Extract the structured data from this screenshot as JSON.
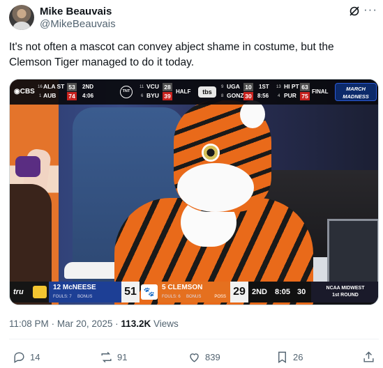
{
  "author": {
    "name": "Mike Beauvais",
    "handle": "@MikeBeauvais"
  },
  "tweet": {
    "text": "It's not often a mascot can convey abject shame in costume, but the Clemson Tiger managed to do it today."
  },
  "media": {
    "top_scoreboard": {
      "games": [
        {
          "network": "CBS",
          "teams": [
            {
              "seed": "16",
              "name": "ALA ST",
              "score": "53",
              "winning": false
            },
            {
              "seed": "1",
              "name": "AUB",
              "score": "74",
              "winning": true
            }
          ],
          "period": "2ND",
          "clock": "4:06"
        },
        {
          "network": "TNT",
          "teams": [
            {
              "seed": "11",
              "name": "VCU",
              "score": "28",
              "winning": false
            },
            {
              "seed": "6",
              "name": "BYU",
              "score": "39",
              "winning": true
            }
          ],
          "period": "HALF",
          "clock": ""
        },
        {
          "network": "tbs",
          "teams": [
            {
              "seed": "9",
              "name": "UGA",
              "score": "10",
              "winning": false
            },
            {
              "seed": "8",
              "name": "GONZ",
              "score": "30",
              "winning": true
            }
          ],
          "period": "1ST",
          "clock": "8:56"
        },
        {
          "network": "",
          "teams": [
            {
              "seed": "13",
              "name": "HI PT",
              "score": "63",
              "winning": false
            },
            {
              "seed": "4",
              "name": "PUR",
              "score": "75",
              "winning": true
            }
          ],
          "period": "FINAL",
          "clock": ""
        }
      ],
      "logo_line1": "MARCH",
      "logo_line2": "MADNESS"
    },
    "bottom_scoreboard": {
      "network": "tru",
      "team1": {
        "seed": "12",
        "name": "McNEESE",
        "fouls": "FOULS: 7",
        "bonus": "BONUS",
        "score": "51"
      },
      "team2": {
        "seed": "5",
        "name": "CLEMSON",
        "fouls": "FOULS: 6",
        "bonus": "BONUS",
        "poss": "POSS",
        "score": "29"
      },
      "period": "2ND",
      "clock": "8:05",
      "shot_clock": "30",
      "region_line1": "NCAA MIDWEST",
      "region_line2": "1st ROUND"
    }
  },
  "meta": {
    "time": "11:08 PM",
    "date": "Mar 20, 2025",
    "separator": "·",
    "views_count": "113.2K",
    "views_label": "Views"
  },
  "actions": {
    "replies": "14",
    "reposts": "91",
    "likes": "839",
    "bookmarks": "26"
  },
  "icons": [
    "grok-icon",
    "more-icon",
    "reply-icon",
    "repost-icon",
    "like-icon",
    "bookmark-icon",
    "share-icon"
  ]
}
